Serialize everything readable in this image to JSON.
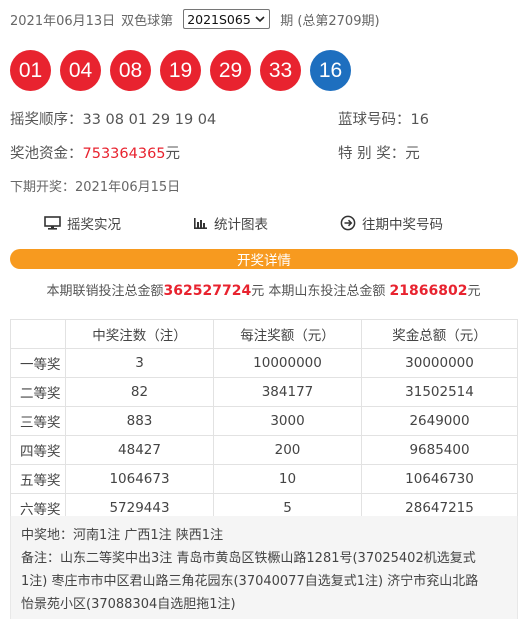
{
  "header": {
    "date": "2021年06月13日",
    "lottery_name": "双色球第",
    "issue_selected": "2021S065",
    "period_text": "期 (总第2709期)"
  },
  "balls": {
    "red": [
      "01",
      "04",
      "08",
      "19",
      "29",
      "33"
    ],
    "blue": "16",
    "red_color": "#e8232f",
    "blue_color": "#1e6fbf"
  },
  "info": {
    "order_label": "摇奖顺序：",
    "order_value": "33 08 01 29 19 04",
    "blue_label": "蓝球号码：",
    "blue_value": "16",
    "pool_label": "奖池资金：",
    "pool_value": "753364365",
    "pool_unit": "元",
    "special_label": "特 别 奖：",
    "special_unit": "元",
    "next_draw": "下期开奖：2021年06月15日"
  },
  "nav": {
    "live": "摇奖实况",
    "chart": "统计图表",
    "history": "往期中奖号码"
  },
  "detail_bar": "开奖详情",
  "sales": {
    "national_label": "本期联销投注总金额",
    "national_value": "362527724",
    "unit": "元",
    "local_label": " 本期山东投注总金额 ",
    "local_value": "21866802"
  },
  "prize_table": {
    "headers": [
      "",
      "中奖注数（注）",
      "每注奖额（元）",
      "奖金总额（元）"
    ],
    "rows": [
      {
        "rank": "一等奖",
        "count": "3",
        "per": "10000000",
        "total": "30000000"
      },
      {
        "rank": "二等奖",
        "count": "82",
        "per": "384177",
        "total": "31502514"
      },
      {
        "rank": "三等奖",
        "count": "883",
        "per": "3000",
        "total": "2649000"
      },
      {
        "rank": "四等奖",
        "count": "48427",
        "per": "200",
        "total": "9685400"
      },
      {
        "rank": "五等奖",
        "count": "1064673",
        "per": "10",
        "total": "10646730"
      },
      {
        "rank": "六等奖",
        "count": "5729443",
        "per": "5",
        "total": "28647215"
      }
    ]
  },
  "notes": {
    "winners_location": "中奖地：河南1注 广西1注 陕西1注",
    "line1": "备注：山东二等奖中出3注 青岛市黄岛区铁橛山路1281号(37025402机选复式",
    "line2": "1注) 枣庄市市中区君山路三角花园东(37040077自选复式1注) 济宁市兖山北路",
    "line3": "怡景苑小区(37088304自选胆拖1注)"
  }
}
